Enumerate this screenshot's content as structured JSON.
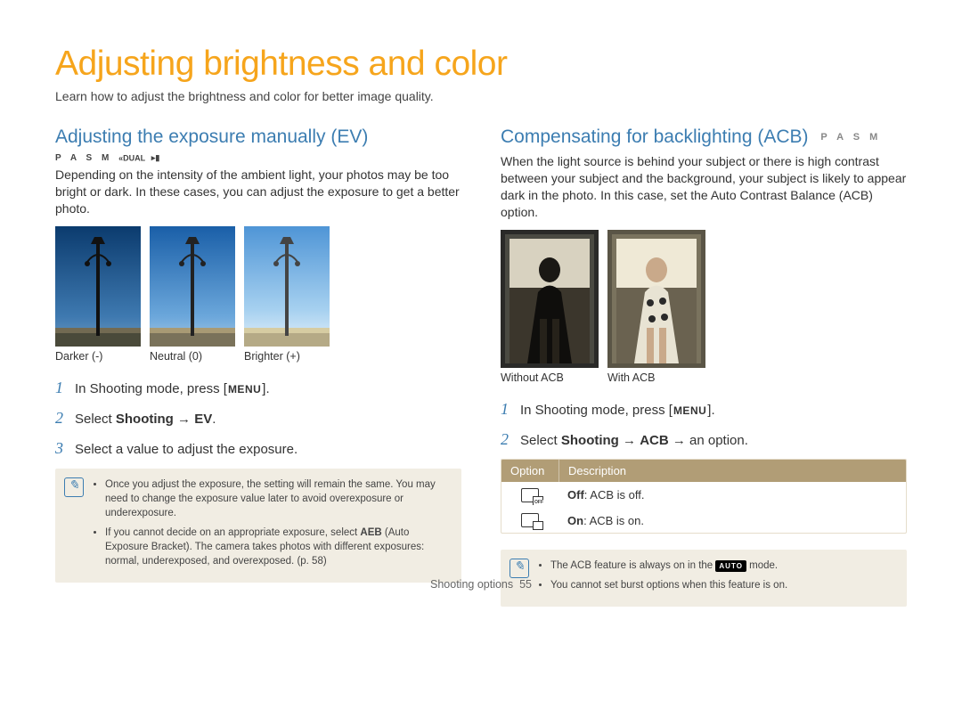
{
  "page": {
    "title": "Adjusting brightness and color",
    "subtitle": "Learn how to adjust the brightness and color for better image quality."
  },
  "ev": {
    "heading": "Adjusting the exposure manually (EV)",
    "modes": "P A S M",
    "mode_extra1": "«DUAL",
    "mode_extra2": "▸▮",
    "body": "Depending on the intensity of the ambient light, your photos may be too bright or dark. In these cases, you can adjust the exposure to get a better photo.",
    "captions": {
      "darker": "Darker (-)",
      "neutral": "Neutral (0)",
      "brighter": "Brighter (+)"
    },
    "steps": {
      "s1a": "In Shooting mode, press [",
      "menu": "MENU",
      "s1b": "].",
      "s2a": "Select ",
      "s2b": "Shooting",
      "s2c": " → ",
      "s2d": "EV",
      "s2e": ".",
      "s3": "Select a value to adjust the exposure."
    },
    "notes": {
      "n1": "Once you adjust the exposure, the setting will remain the same. You may need to change the exposure value later to avoid overexposure or underexposure.",
      "n2a": "If you cannot decide on an appropriate exposure, select ",
      "n2b": "AEB",
      "n2c": " (Auto Exposure Bracket). The camera takes photos with different exposures: normal, underexposed, and overexposed. (p. 58)"
    }
  },
  "acb": {
    "heading": "Compensating for backlighting (ACB)",
    "modes": "P A S M",
    "body": "When the light source is behind your subject or there is high contrast between your subject and the background, your subject is likely to appear dark in the photo. In this case, set the Auto Contrast Balance (ACB) option.",
    "captions": {
      "without": "Without ACB",
      "with": "With ACB"
    },
    "steps": {
      "s1a": "In Shooting mode, press [",
      "menu": "MENU",
      "s1b": "].",
      "s2a": "Select ",
      "s2b": "Shooting",
      "s2c": " → ",
      "s2d": "ACB",
      "s2e": " → an option."
    },
    "table": {
      "h_option": "Option",
      "h_desc": "Description",
      "off_label": "Off",
      "off_desc": ": ACB is off.",
      "on_label": "On",
      "on_desc": ": ACB is on."
    },
    "notes": {
      "n1a": "The ACB feature is always on in the ",
      "n1b": "AUTO",
      "n1c": " mode.",
      "n2": "You cannot set burst options when this feature is on."
    }
  },
  "footer": {
    "section": "Shooting options",
    "page_num": "55"
  }
}
